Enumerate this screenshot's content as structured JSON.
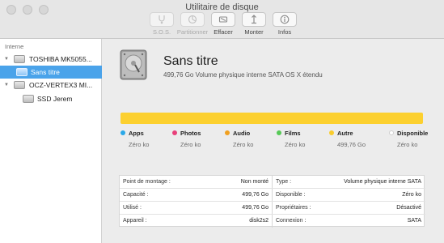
{
  "window": {
    "title": "Utilitaire de disque"
  },
  "toolbar": {
    "items": [
      {
        "label": "S.O.S.",
        "icon": "stethoscope-icon",
        "enabled": false
      },
      {
        "label": "Partitionner",
        "icon": "partition-icon",
        "enabled": false
      },
      {
        "label": "Effacer",
        "icon": "erase-icon",
        "enabled": true
      },
      {
        "label": "Monter",
        "icon": "mount-icon",
        "enabled": true
      },
      {
        "label": "Infos",
        "icon": "info-icon",
        "enabled": true
      }
    ]
  },
  "sidebar": {
    "header": "Interne",
    "items": [
      {
        "label": "TOSHIBA MK5055...",
        "type": "disk",
        "expanded": true,
        "selected": false
      },
      {
        "label": "Sans titre",
        "type": "volume",
        "selected": true
      },
      {
        "label": "OCZ-VERTEX3 MI...",
        "type": "disk",
        "expanded": true,
        "selected": false
      },
      {
        "label": "SSD Jerem",
        "type": "volume",
        "selected": false
      }
    ]
  },
  "volume": {
    "name": "Sans titre",
    "description": "499,76 Go Volume physique interne SATA OS X étendu"
  },
  "usage_bar": {
    "color": "#fcd02f",
    "fill_fraction": 1.0
  },
  "legend": [
    {
      "name": "Apps",
      "value": "Zéro ko",
      "color": "#2aa8e8"
    },
    {
      "name": "Photos",
      "value": "Zéro ko",
      "color": "#e8407a"
    },
    {
      "name": "Audio",
      "value": "Zéro ko",
      "color": "#f0a020"
    },
    {
      "name": "Films",
      "value": "Zéro ko",
      "color": "#56c956"
    },
    {
      "name": "Autre",
      "value": "499,76 Go",
      "color": "#f9cc2c"
    },
    {
      "name": "Disponible",
      "value": "Zéro ko",
      "color": "#ffffff"
    }
  ],
  "info": {
    "left": [
      {
        "key": "Point de montage :",
        "value": "Non monté"
      },
      {
        "key": "Capacité :",
        "value": "499,76 Go"
      },
      {
        "key": "Utilisé :",
        "value": "499,76 Go"
      },
      {
        "key": "Appareil :",
        "value": "disk2s2"
      }
    ],
    "right": [
      {
        "key": "Type :",
        "value": "Volume physique interne SATA"
      },
      {
        "key": "Disponible :",
        "value": "Zéro ko"
      },
      {
        "key": "Propriétaires :",
        "value": "Désactivé"
      },
      {
        "key": "Connexion :",
        "value": "SATA"
      }
    ]
  }
}
